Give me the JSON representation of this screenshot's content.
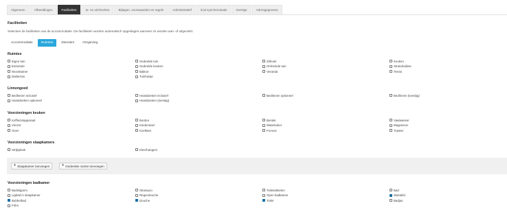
{
  "tabs": [
    "Algemeen",
    "Afbeeldingen",
    "Faciliteiten",
    "In- en uitchecken",
    "Bijlagen, voorwaarden en regels",
    "Administratief",
    "iCal synchronisatie",
    "Overige",
    "Adresgegevens"
  ],
  "active_tab": 2,
  "title": "Faciliteiten",
  "description": "Selecteer de faciliteiten van de accommodatie. De faciliteiten worden automatisch opgeslagen wanneer ze worden aan- of uitgevinkt.",
  "subtabs": [
    "Accommodatie",
    "Ruimtes",
    "Diensten",
    "Omgeving"
  ],
  "active_subtab": 1,
  "groups": {
    "ruimtes": {
      "title": "Ruimtes",
      "items": [
        {
          "label": "Eigen tuin",
          "checked": false
        },
        {
          "label": "Gedeelde tuin",
          "checked": false
        },
        {
          "label": "Zithoek",
          "checked": false
        },
        {
          "label": "Keuken",
          "checked": false
        },
        {
          "label": "Eetruimte",
          "checked": false
        },
        {
          "label": "Gedeelde keuken",
          "checked": false
        },
        {
          "label": "Omheinde tuin",
          "checked": false
        },
        {
          "label": "Strandcabine",
          "checked": false
        },
        {
          "label": "Woonkamer",
          "checked": false
        },
        {
          "label": "Balkon",
          "checked": false
        },
        {
          "label": "Veranda",
          "checked": false
        },
        {
          "label": "Terras",
          "checked": false
        },
        {
          "label": "Dakterras",
          "checked": false
        },
        {
          "label": "Tuinhuisje",
          "checked": false
        }
      ]
    },
    "linnengoed": {
      "title": "Linnengoed",
      "items": [
        {
          "label": "Bedlinnen inclusief",
          "checked": false
        },
        {
          "label": "Handdoeken inclusief",
          "checked": false
        },
        {
          "label": "Bedlinnen optioneel",
          "checked": false
        },
        {
          "label": "Bedlinnen (toeslag)",
          "checked": false
        },
        {
          "label": "Handdoeken optioneel",
          "checked": false
        },
        {
          "label": "Handdoeken (toeslag)",
          "checked": false
        }
      ]
    },
    "keuken": {
      "title": "Voorzieningen keuken",
      "items": [
        {
          "label": "Koffiezetapparaat",
          "checked": false
        },
        {
          "label": "Borden",
          "checked": false
        },
        {
          "label": "Bestek",
          "checked": false
        },
        {
          "label": "Vaatwasser",
          "checked": false
        },
        {
          "label": "Vriezer",
          "checked": false
        },
        {
          "label": "Kinderstoel",
          "checked": false
        },
        {
          "label": "Waterkoker",
          "checked": false
        },
        {
          "label": "Magnetron",
          "checked": false
        },
        {
          "label": "Oven",
          "checked": false
        },
        {
          "label": "Koelkast",
          "checked": false
        },
        {
          "label": "Fornuis",
          "checked": false
        },
        {
          "label": "Toaster",
          "checked": false
        }
      ]
    },
    "slaapkamers": {
      "title": "Voorzieningen slaapkamers",
      "items": [
        {
          "label": "Strijkplank",
          "checked": false
        },
        {
          "label": "Kleerhangers",
          "checked": false
        }
      ]
    },
    "badkamer": {
      "title": "Voorzieningen badkamer",
      "items": [
        {
          "label": "Badslippers",
          "checked": false
        },
        {
          "label": "Shampoo",
          "checked": false
        },
        {
          "label": "Toiletartikelen",
          "checked": false
        },
        {
          "label": "Bad",
          "checked": false
        },
        {
          "label": "Ligbad in slaapkamer",
          "checked": false
        },
        {
          "label": "Regendouche",
          "checked": false
        },
        {
          "label": "Open badkamer",
          "checked": false
        },
        {
          "label": "Wastafel",
          "checked": true
        },
        {
          "label": "Bubbelbad",
          "checked": true
        },
        {
          "label": "Douche",
          "checked": true
        },
        {
          "label": "Toilet",
          "checked": true
        },
        {
          "label": "Badjas",
          "checked": false
        },
        {
          "label": "Föhn",
          "checked": false
        }
      ]
    }
  },
  "buttons": {
    "add_bedroom": "Slaapkamer toevoegen",
    "add_shared_room": "Gedeelde ruimte toevoegen"
  }
}
